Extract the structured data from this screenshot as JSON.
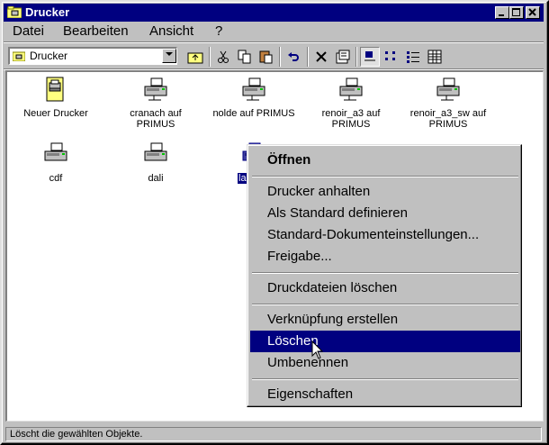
{
  "window": {
    "title": "Drucker"
  },
  "menubar": [
    {
      "label": "Datei"
    },
    {
      "label": "Bearbeiten"
    },
    {
      "label": "Ansicht"
    },
    {
      "label": "?"
    }
  ],
  "toolbar": {
    "address_value": "Drucker"
  },
  "icons": [
    {
      "label": "Neuer Drucker"
    },
    {
      "label": "cranach auf PRIMUS"
    },
    {
      "label": "nolde auf PRIMUS"
    },
    {
      "label": "renoir_a3 auf PRIMUS"
    },
    {
      "label": "renoir_a3_sw auf PRIMUS"
    },
    {
      "label": "cdf"
    },
    {
      "label": "dali"
    },
    {
      "label": "la"
    }
  ],
  "context_menu": {
    "open": "Öffnen",
    "pause": "Drucker anhalten",
    "set_default": "Als Standard definieren",
    "doc_defaults": "Standard-Dokumenteinstellungen...",
    "sharing": "Freigabe...",
    "purge": "Druckdateien löschen",
    "shortcut": "Verknüpfung erstellen",
    "delete": "Löschen",
    "rename": "Umbenennen",
    "properties": "Eigenschaften"
  },
  "statusbar": {
    "text": "Löscht die gewählten Objekte."
  }
}
